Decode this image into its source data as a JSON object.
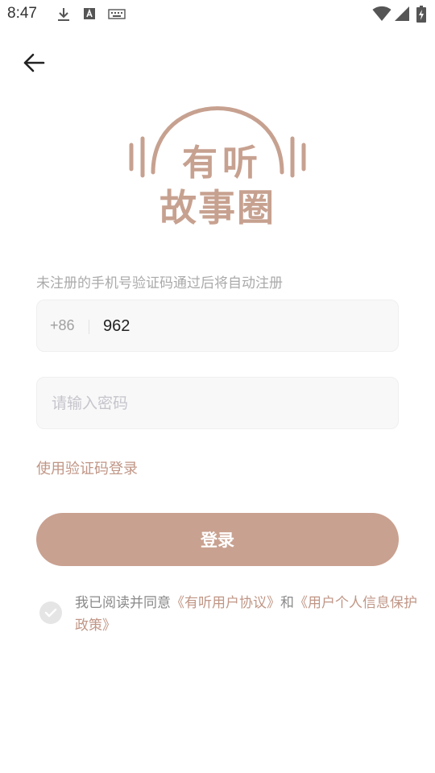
{
  "status_bar": {
    "time": "8:47",
    "left_icons": [
      "download-icon",
      "text-a-icon",
      "keyboard-icon"
    ],
    "right_icons": [
      "wifi-icon",
      "cell-signal-icon",
      "battery-charging-icon"
    ]
  },
  "logo": {
    "line1": "有听",
    "line2": "故事圈"
  },
  "form": {
    "hint": "未注册的手机号验证码通过后将自动注册",
    "country_code": "+86",
    "phone_value": "962",
    "password_placeholder": "请输入密码",
    "code_login_label": "使用验证码登录",
    "login_label": "登录"
  },
  "agreement": {
    "prefix": "我已阅读并同意",
    "link1": "《有听用户协议》",
    "middle": "和",
    "link2": "《用户个人信息保护政策》"
  },
  "colors": {
    "accent": "#c9a190",
    "link": "#c09686",
    "field_bg": "#f8f8f8"
  }
}
